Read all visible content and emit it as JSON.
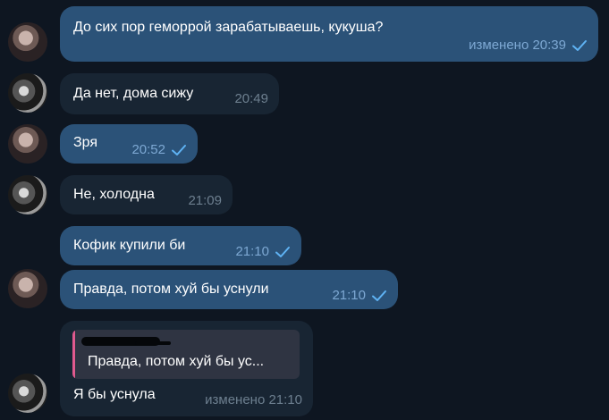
{
  "messages": [
    {
      "text": "До сих пор геморрой зарабатываешь, кукуша?",
      "meta": "изменено 20:39"
    },
    {
      "text": "Да нет, дома сижу",
      "meta": "20:49"
    },
    {
      "text": "Зря",
      "meta": "20:52"
    },
    {
      "text": "Не, холодна",
      "meta": "21:09"
    },
    {
      "text": "Кофик купили би",
      "meta": "21:10"
    },
    {
      "text": "Правда, потом хуй бы уснули",
      "meta": "21:10"
    },
    {
      "reply_preview": "Правда, потом хуй бы ус...",
      "text": "Я бы уснула",
      "meta": "изменено 21:10"
    }
  ],
  "colors": {
    "background": "#0e1621",
    "outgoing_bubble": "#2b5278",
    "incoming_bubble": "#182533",
    "read_check": "#5fb3f4",
    "reply_accent": "#e05a8e"
  },
  "icons": [
    "avatar-outgoing",
    "avatar-incoming",
    "read-check-icon"
  ]
}
